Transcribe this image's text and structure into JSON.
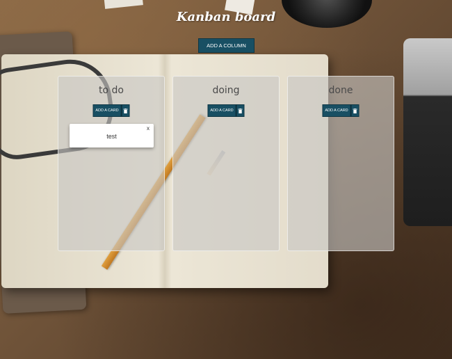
{
  "app": {
    "title": "Kanban board"
  },
  "toolbar": {
    "add_column_label": "ADD A COLUMN"
  },
  "columns": [
    {
      "title": "to do",
      "add_card_label": "ADD A CARD",
      "delete_icon": "trash-icon",
      "cards": [
        {
          "text": "test",
          "close_label": "x"
        }
      ]
    },
    {
      "title": "doing",
      "add_card_label": "ADD A CARD",
      "delete_icon": "trash-icon",
      "cards": []
    },
    {
      "title": "done",
      "add_card_label": "ADD A CARD",
      "delete_icon": "trash-icon",
      "cards": []
    }
  ],
  "colors": {
    "button": "#184f63",
    "column_bg": "#c8c6c4",
    "card_bg": "#ffffff",
    "title_text": "#ffffff"
  }
}
